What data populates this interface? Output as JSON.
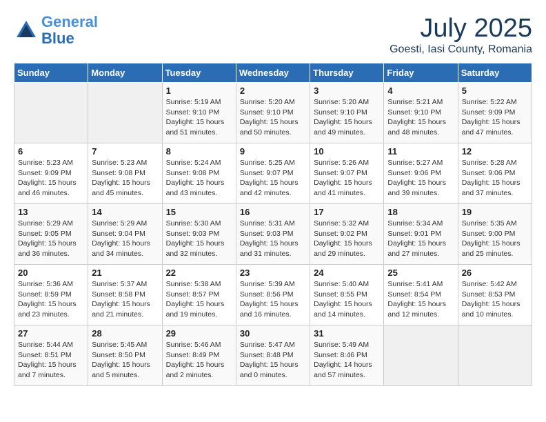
{
  "header": {
    "logo_line1": "General",
    "logo_line2": "Blue",
    "month": "July 2025",
    "location": "Goesti, Iasi County, Romania"
  },
  "days_of_week": [
    "Sunday",
    "Monday",
    "Tuesday",
    "Wednesday",
    "Thursday",
    "Friday",
    "Saturday"
  ],
  "weeks": [
    [
      {
        "day": "",
        "info": ""
      },
      {
        "day": "",
        "info": ""
      },
      {
        "day": "1",
        "info": "Sunrise: 5:19 AM\nSunset: 9:10 PM\nDaylight: 15 hours\nand 51 minutes."
      },
      {
        "day": "2",
        "info": "Sunrise: 5:20 AM\nSunset: 9:10 PM\nDaylight: 15 hours\nand 50 minutes."
      },
      {
        "day": "3",
        "info": "Sunrise: 5:20 AM\nSunset: 9:10 PM\nDaylight: 15 hours\nand 49 minutes."
      },
      {
        "day": "4",
        "info": "Sunrise: 5:21 AM\nSunset: 9:10 PM\nDaylight: 15 hours\nand 48 minutes."
      },
      {
        "day": "5",
        "info": "Sunrise: 5:22 AM\nSunset: 9:09 PM\nDaylight: 15 hours\nand 47 minutes."
      }
    ],
    [
      {
        "day": "6",
        "info": "Sunrise: 5:23 AM\nSunset: 9:09 PM\nDaylight: 15 hours\nand 46 minutes."
      },
      {
        "day": "7",
        "info": "Sunrise: 5:23 AM\nSunset: 9:08 PM\nDaylight: 15 hours\nand 45 minutes."
      },
      {
        "day": "8",
        "info": "Sunrise: 5:24 AM\nSunset: 9:08 PM\nDaylight: 15 hours\nand 43 minutes."
      },
      {
        "day": "9",
        "info": "Sunrise: 5:25 AM\nSunset: 9:07 PM\nDaylight: 15 hours\nand 42 minutes."
      },
      {
        "day": "10",
        "info": "Sunrise: 5:26 AM\nSunset: 9:07 PM\nDaylight: 15 hours\nand 41 minutes."
      },
      {
        "day": "11",
        "info": "Sunrise: 5:27 AM\nSunset: 9:06 PM\nDaylight: 15 hours\nand 39 minutes."
      },
      {
        "day": "12",
        "info": "Sunrise: 5:28 AM\nSunset: 9:06 PM\nDaylight: 15 hours\nand 37 minutes."
      }
    ],
    [
      {
        "day": "13",
        "info": "Sunrise: 5:29 AM\nSunset: 9:05 PM\nDaylight: 15 hours\nand 36 minutes."
      },
      {
        "day": "14",
        "info": "Sunrise: 5:29 AM\nSunset: 9:04 PM\nDaylight: 15 hours\nand 34 minutes."
      },
      {
        "day": "15",
        "info": "Sunrise: 5:30 AM\nSunset: 9:03 PM\nDaylight: 15 hours\nand 32 minutes."
      },
      {
        "day": "16",
        "info": "Sunrise: 5:31 AM\nSunset: 9:03 PM\nDaylight: 15 hours\nand 31 minutes."
      },
      {
        "day": "17",
        "info": "Sunrise: 5:32 AM\nSunset: 9:02 PM\nDaylight: 15 hours\nand 29 minutes."
      },
      {
        "day": "18",
        "info": "Sunrise: 5:34 AM\nSunset: 9:01 PM\nDaylight: 15 hours\nand 27 minutes."
      },
      {
        "day": "19",
        "info": "Sunrise: 5:35 AM\nSunset: 9:00 PM\nDaylight: 15 hours\nand 25 minutes."
      }
    ],
    [
      {
        "day": "20",
        "info": "Sunrise: 5:36 AM\nSunset: 8:59 PM\nDaylight: 15 hours\nand 23 minutes."
      },
      {
        "day": "21",
        "info": "Sunrise: 5:37 AM\nSunset: 8:58 PM\nDaylight: 15 hours\nand 21 minutes."
      },
      {
        "day": "22",
        "info": "Sunrise: 5:38 AM\nSunset: 8:57 PM\nDaylight: 15 hours\nand 19 minutes."
      },
      {
        "day": "23",
        "info": "Sunrise: 5:39 AM\nSunset: 8:56 PM\nDaylight: 15 hours\nand 16 minutes."
      },
      {
        "day": "24",
        "info": "Sunrise: 5:40 AM\nSunset: 8:55 PM\nDaylight: 15 hours\nand 14 minutes."
      },
      {
        "day": "25",
        "info": "Sunrise: 5:41 AM\nSunset: 8:54 PM\nDaylight: 15 hours\nand 12 minutes."
      },
      {
        "day": "26",
        "info": "Sunrise: 5:42 AM\nSunset: 8:53 PM\nDaylight: 15 hours\nand 10 minutes."
      }
    ],
    [
      {
        "day": "27",
        "info": "Sunrise: 5:44 AM\nSunset: 8:51 PM\nDaylight: 15 hours\nand 7 minutes."
      },
      {
        "day": "28",
        "info": "Sunrise: 5:45 AM\nSunset: 8:50 PM\nDaylight: 15 hours\nand 5 minutes."
      },
      {
        "day": "29",
        "info": "Sunrise: 5:46 AM\nSunset: 8:49 PM\nDaylight: 15 hours\nand 2 minutes."
      },
      {
        "day": "30",
        "info": "Sunrise: 5:47 AM\nSunset: 8:48 PM\nDaylight: 15 hours\nand 0 minutes."
      },
      {
        "day": "31",
        "info": "Sunrise: 5:49 AM\nSunset: 8:46 PM\nDaylight: 14 hours\nand 57 minutes."
      },
      {
        "day": "",
        "info": ""
      },
      {
        "day": "",
        "info": ""
      }
    ]
  ]
}
